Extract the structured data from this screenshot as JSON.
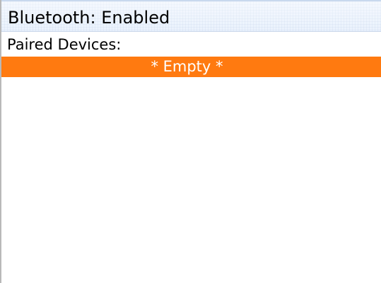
{
  "title_bar": {
    "title": "Bluetooth: Enabled"
  },
  "paired_devices": {
    "heading": "Paired Devices:",
    "items": [
      {
        "label": "* Empty *",
        "selected": true
      }
    ]
  },
  "colors": {
    "title_bar_background": "#eaf2fd",
    "selection_highlight": "#ff7a10",
    "selection_text": "#ffffff",
    "background": "#ffffff",
    "text": "#000000"
  }
}
